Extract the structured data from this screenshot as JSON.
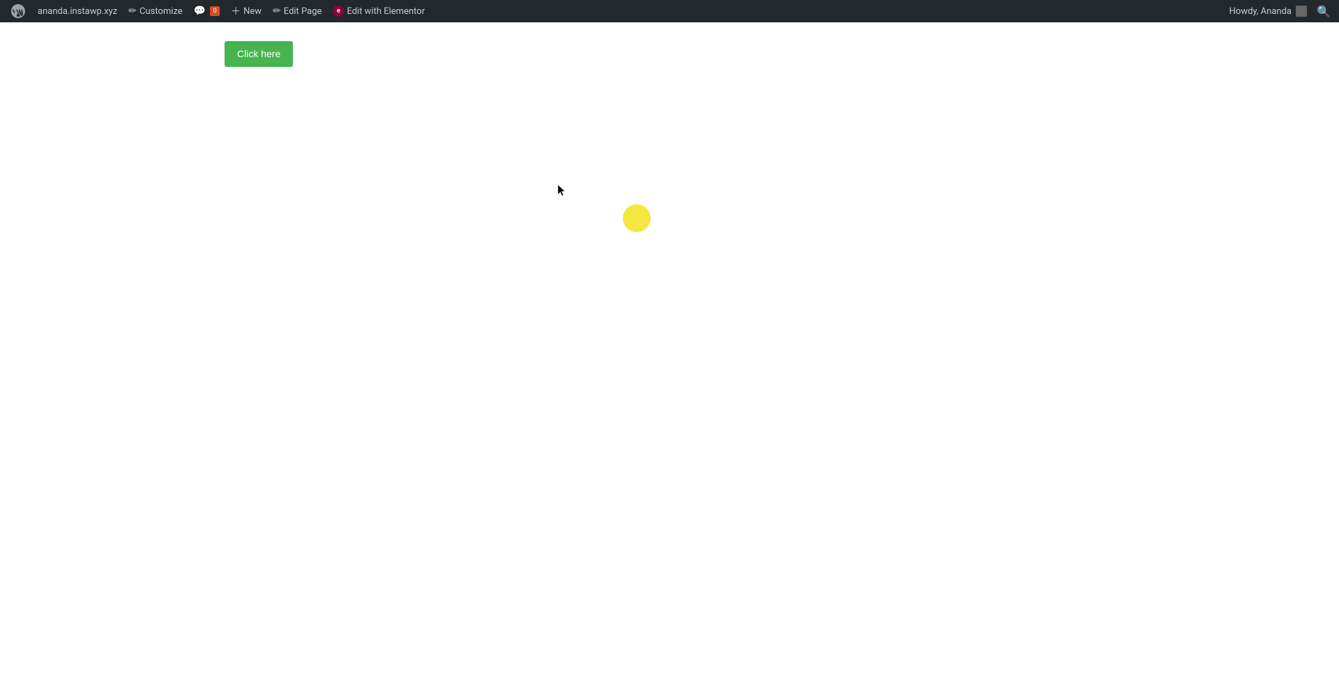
{
  "adminbar": {
    "site_url": "ananda.instawp.xyz",
    "customize_label": "Customize",
    "comments_label": "0",
    "new_label": "New",
    "edit_page_label": "Edit Page",
    "edit_with_elementor_label": "Edit with Elementor",
    "howdy_label": "Howdy, Ananda",
    "colors": {
      "bar_bg": "#23282d",
      "bar_text": "#cccccc",
      "bar_hover": "#32373c"
    }
  },
  "page": {
    "click_here_label": "Click here",
    "colors": {
      "button_bg": "#46b450",
      "button_text": "#ffffff",
      "circle_color": "#f5e642"
    }
  }
}
